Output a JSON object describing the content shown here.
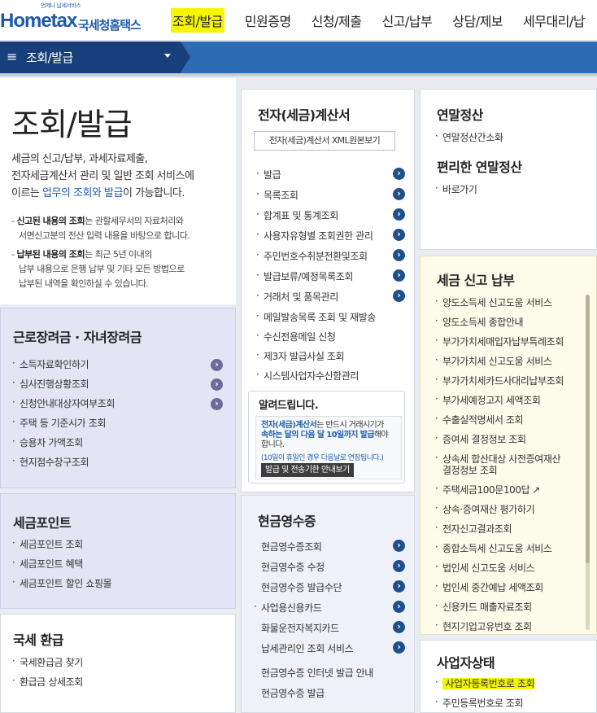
{
  "logo": {
    "small": "언제나 납세서비스",
    "main": "Hometax",
    "korean": "국세청홈택스"
  },
  "gnb": [
    "조회/발급",
    "민원증명",
    "신청/제출",
    "신고/납부",
    "상담/제보",
    "세무대리/납"
  ],
  "breadcrumb": {
    "title": "조회/발급"
  },
  "hero": {
    "title": "조회/발급",
    "desc_line1": "세금의 신고/납부, 과세자료제출,",
    "desc_line2": "전자세금계산서 관리 및 일반 조회 서비스에",
    "desc_line3_pre": "이르는 ",
    "desc_line3_hl": "업무의 조회와 발급",
    "desc_line3_post": "이 가능합니다.",
    "note1_b": "신고된 내용의 조회",
    "note1_a": "는 관할세무서의 자료처리와",
    "note1_l2": "서면신고분의 전산 입력 내용을 바탕으로 합니다.",
    "note2_b": "납부된 내용의 조회",
    "note2_a": "는 최근 5년 이내의",
    "note2_l2": "납부 내용으로 은행 납부 및 기타 모든 방법으로",
    "note2_l3": "납부된 내역을 확인하실 수 있습니다."
  },
  "labor": {
    "title": "근로장려금 · 자녀장려금",
    "items": [
      "소득자료확인하기",
      "심사진행상황조회",
      "신청안내대상자여부조회",
      "주택 등 기준시가 조회",
      "승용차 가액조회",
      "현지점수창구조회"
    ]
  },
  "point": {
    "title": "세금포인트",
    "items": [
      "세금포인트 조회",
      "세금포인트 혜택",
      "세금포인트 할인 쇼핑몰"
    ]
  },
  "refund": {
    "title": "국세 환급",
    "items": [
      "국세환급금 찾기",
      "환급금 상세조회"
    ]
  },
  "einvoice": {
    "title": "전자(세금)계산서",
    "xml_button": "전자(세금)계산서 XML원본보기",
    "items": [
      "발급",
      "목록조회",
      "합계표 및 통계조회",
      "사용자유형별 조회권한 관리",
      "주민번호수취분전환및조회",
      "발급보류/예정목록조회",
      "거래처 및 품목관리",
      "메일발송목록 조회 및 재발송",
      "수신전용메일 신청",
      "제3자 발급사실 조회",
      "시스템사업자수신함관리"
    ],
    "notice": {
      "title": "알려드립니다.",
      "l1_b": "전자(세금)계산서",
      "l1_a": "는 반드시 거래시기가",
      "l2_b": "속하는 달의 다음 달 10일까지 발급",
      "l2_a": "해야",
      "l3": "합니다.",
      "small": "(10일이 휴일인 경우 다음날로 연장됩니다.)",
      "button": "발급 및 전송기한 안내보기"
    }
  },
  "cash": {
    "title": "현금영수증",
    "items": [
      "현금영수증조회",
      "현금영수증 수정",
      "현금영수증 발급수단",
      "사업용신용카드",
      "화물운전자복지카드",
      "납세관리인 조회 서비스",
      "현금영수증 인터넷 발급 안내",
      "현금영수증 발급"
    ]
  },
  "yearend": {
    "title": "연말정산",
    "items": [
      "연말정산간소화"
    ],
    "title2": "편리한 연말정산",
    "items2": [
      "바로가기"
    ]
  },
  "taxfile": {
    "title": "세금 신고 납부",
    "items": [
      "양도소득세 신고도움 서비스",
      "양도소득세 종합안내",
      "부가가치세매입자납부특례조회",
      "부가가치세 신고도움 서비스",
      "부가가치세카드사대리납부조회",
      "부가세예정고지 세액조회",
      "수출실적명세서 조회",
      "증여세 결정정보 조회",
      "상속세 합산대상 사전증여재산",
      "결정정보 조회",
      "주택세금100문100답",
      "상속·증여재산 평가하기",
      "전자신고결과조회",
      "종합소득세 신고도움 서비스",
      "법인세 신고도움 서비스",
      "법인세 중간예납 세액조회",
      "신용카드 매출자료조회",
      "현지기업고유번호 조회"
    ]
  },
  "bizstatus": {
    "title": "사업자상태",
    "items": [
      "사업자등록번호로 조회",
      "주민등록번호로 조회"
    ]
  }
}
